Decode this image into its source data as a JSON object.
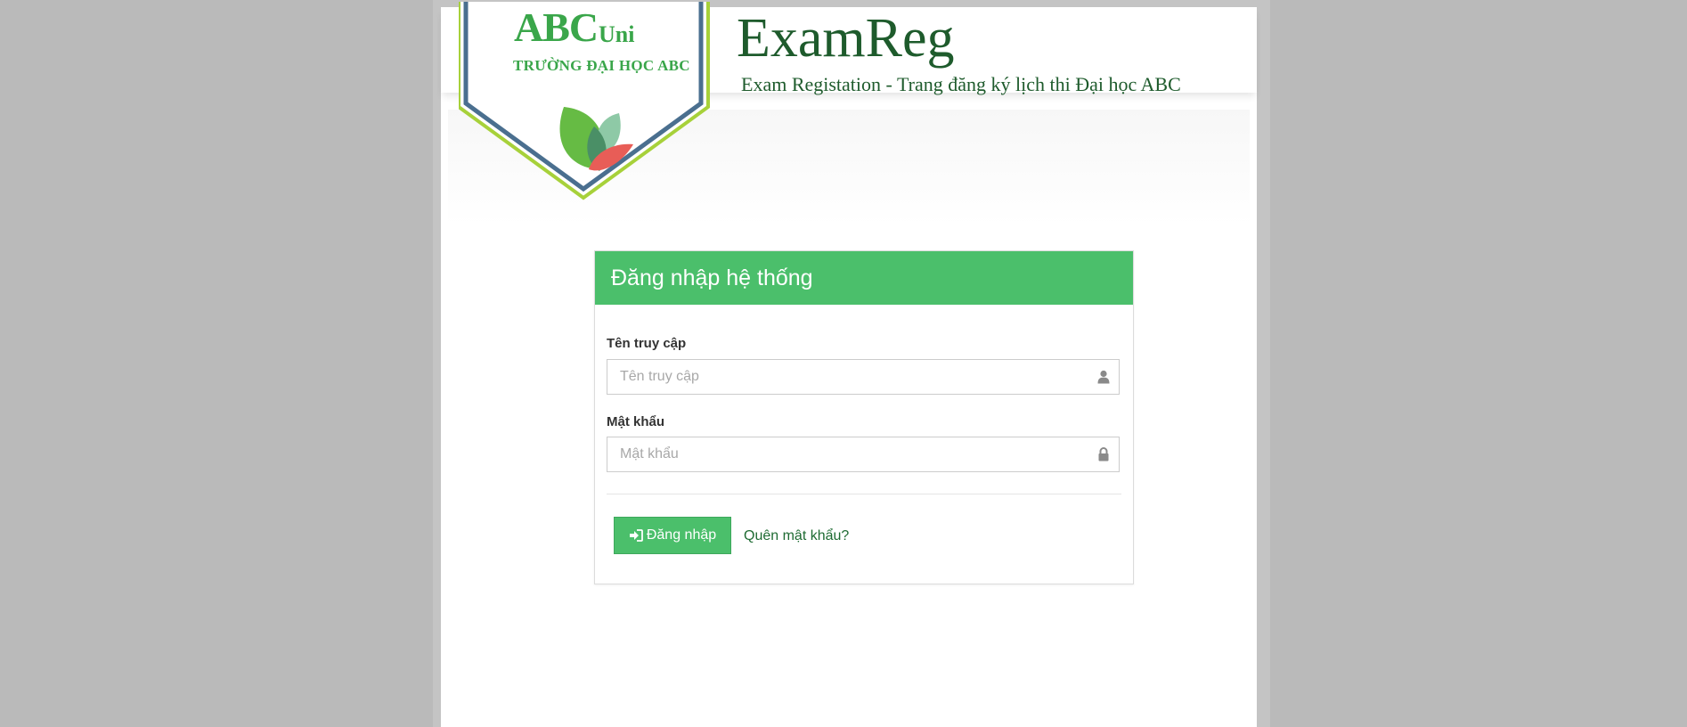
{
  "brand": {
    "abc": "ABC",
    "uni": "Uni",
    "university_name": "TRƯỜNG ĐẠI HỌC ABC"
  },
  "site": {
    "title": "ExamReg",
    "subtitle": "Exam Registation - Trang đăng ký lịch thi Đại học ABC"
  },
  "login_panel": {
    "heading": "Đăng nhập hệ thống",
    "username_label": "Tên truy cập",
    "username_placeholder": "Tên truy cập",
    "username_value": "",
    "password_label": "Mật khẩu",
    "password_placeholder": "Mật khẩu",
    "password_value": "",
    "login_button_label": "Đăng nhập",
    "forgot_password_label": "Quên mật khẩu?"
  },
  "icons": {
    "username_field": "user-icon",
    "password_field": "lock-icon",
    "login_button": "sign-in-icon",
    "logo": "three-leaves-icon"
  },
  "colors": {
    "accent_green": "#4bbf6b",
    "brand_green": "#3aa64a",
    "title_dark_green": "#1e5b2c",
    "shield_blue": "#4a6f8f",
    "shield_lime": "#a7d13a",
    "leaf_red": "#e85d57"
  }
}
